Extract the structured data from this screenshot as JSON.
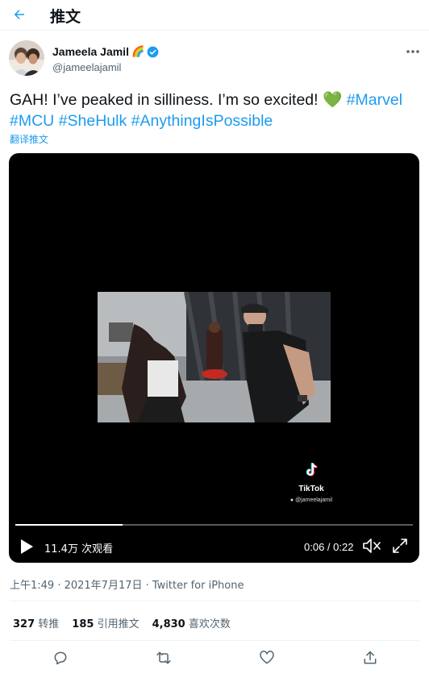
{
  "header": {
    "title": "推文",
    "back_icon": "arrow-left-icon"
  },
  "author": {
    "name": "Jameela Jamil",
    "handle": "@jameelajamil",
    "emoji": "🌈",
    "verified_icon": "verified-badge-icon"
  },
  "tweet": {
    "text_prefix": "GAH! I’ve peaked in silliness. I’m so excited! ",
    "emoji": "💚",
    "hashtags": [
      "#Marvel",
      "#MCU",
      "#SheHulk",
      "#AnythingIsPossible"
    ],
    "translate_label": "翻译推文"
  },
  "video": {
    "views_label": "11.4万 次观看",
    "time_label": "0:06 / 0:22",
    "progress": 0.27,
    "watermark_name": "TikTok",
    "watermark_user": "@jameelajamil"
  },
  "meta": {
    "text": "上午1:49 · 2021年7月17日 · Twitter for iPhone"
  },
  "stats": {
    "retweets_count": "327",
    "retweets_label": "转推",
    "quotes_count": "185",
    "quotes_label": "引用推文",
    "likes_count": "4,830",
    "likes_label": "喜欢次数"
  },
  "colors": {
    "accent": "#1d9bf0",
    "text": "#0f1419",
    "muted": "#536471"
  }
}
